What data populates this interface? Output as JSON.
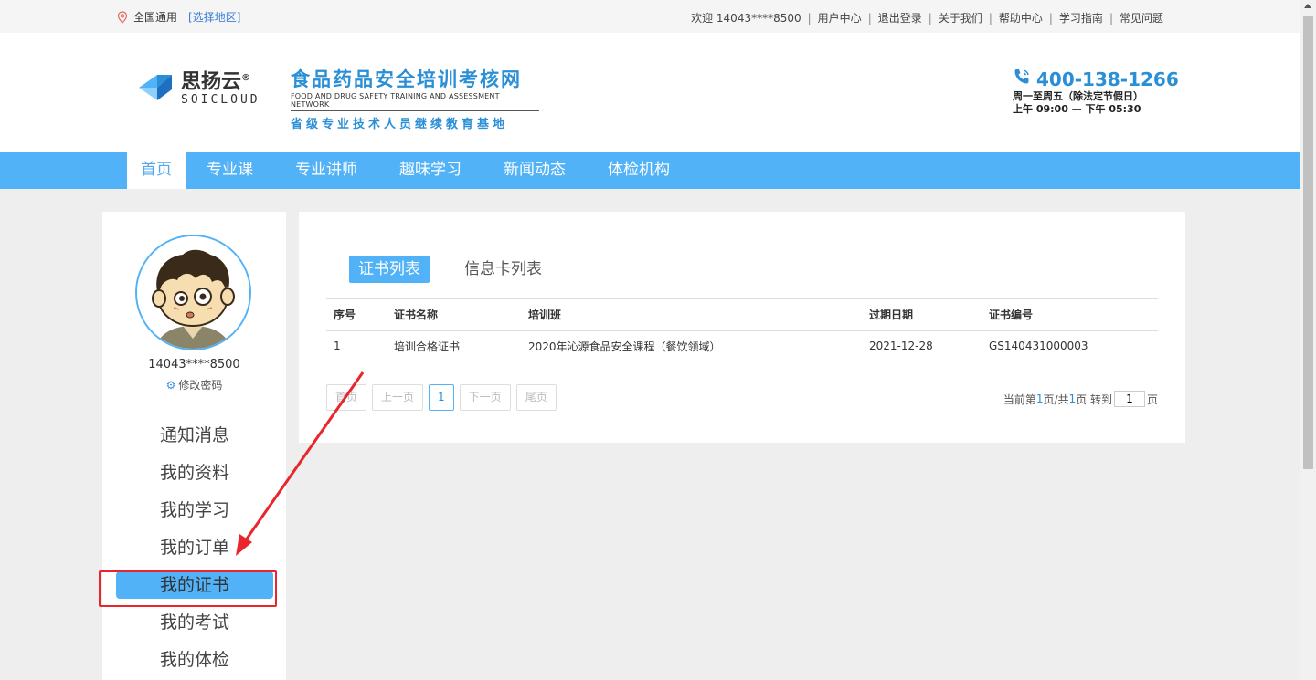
{
  "topbar": {
    "location": "全国通用",
    "select_region": "[选择地区]",
    "welcome": "欢迎 14043****8500",
    "links": [
      "用户中心",
      "退出登录",
      "关于我们",
      "帮助中心",
      "学习指南",
      "常见问题"
    ]
  },
  "header": {
    "logo_cn": "思扬云",
    "logo_reg": "®",
    "logo_en": "SOICLOUD",
    "site_title": "食品药品安全培训考核网",
    "site_en": "FOOD AND DRUG SAFETY TRAINING AND ASSESSMENT NETWORK",
    "site_sub": "省级专业技术人员继续教育基地",
    "phone": "400-138-1266",
    "hours1": "周一至周五（除法定节假日）",
    "hours2": "上午 09:00 — 下午 05:30"
  },
  "nav": {
    "items": [
      "首页",
      "专业课",
      "专业讲师",
      "趣味学习",
      "新闻动态",
      "体检机构"
    ],
    "active_index": 0
  },
  "sidebar": {
    "username": "14043****8500",
    "change_password": "修改密码",
    "menu": [
      "通知消息",
      "我的资料",
      "我的学习",
      "我的订单",
      "我的证书",
      "我的考试",
      "我的体检"
    ],
    "active_index": 4
  },
  "main": {
    "tabs": [
      "证书列表",
      "信息卡列表"
    ],
    "active_tab": 0,
    "table": {
      "headers": [
        "序号",
        "证书名称",
        "培训班",
        "过期日期",
        "证书编号"
      ],
      "rows": [
        [
          "1",
          "培训合格证书",
          "2020年沁源食品安全课程（餐饮领域）",
          "2021-12-28",
          "GS140431000003"
        ]
      ]
    },
    "pager": {
      "first": "首页",
      "prev": "上一页",
      "current": "1",
      "next": "下一页",
      "last": "尾页",
      "info_prefix": "当前第",
      "info_page": "1",
      "info_mid": "页/共",
      "info_total": "1",
      "info_suffix": "页 转到",
      "goto_value": "1",
      "goto_unit": "页"
    }
  },
  "colors": {
    "accent": "#52b2f8",
    "annotation": "#e8262c"
  }
}
